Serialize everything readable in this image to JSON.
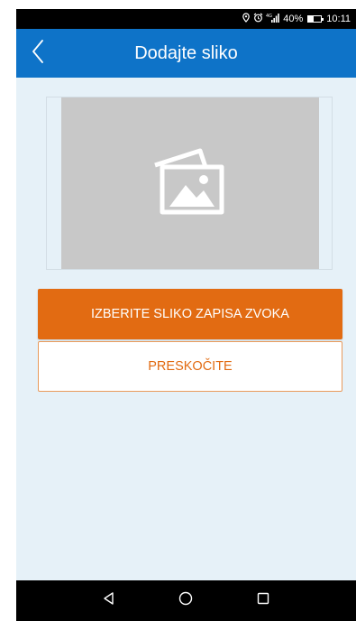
{
  "status_bar": {
    "battery_percent": "40%",
    "battery_level": 0.4,
    "time": "10:11",
    "icons": [
      "location-icon",
      "alarm-icon",
      "signal-icon",
      "battery-icon"
    ]
  },
  "app_bar": {
    "back_icon": "chevron-left-icon",
    "title": "Dodajte sliko"
  },
  "image_area": {
    "icon": "photos-icon"
  },
  "buttons": {
    "choose_label": "IZBERITE SLIKO ZAPISA ZVOKA",
    "skip_label": "PRESKOČITE"
  },
  "nav_bar": {
    "items": [
      "back-triangle-icon",
      "home-circle-icon",
      "recents-square-icon"
    ]
  },
  "colors": {
    "app_bar": "#0e73c8",
    "accent": "#e26b12",
    "background": "#e6f1f8",
    "placeholder": "#c8c8c8"
  }
}
